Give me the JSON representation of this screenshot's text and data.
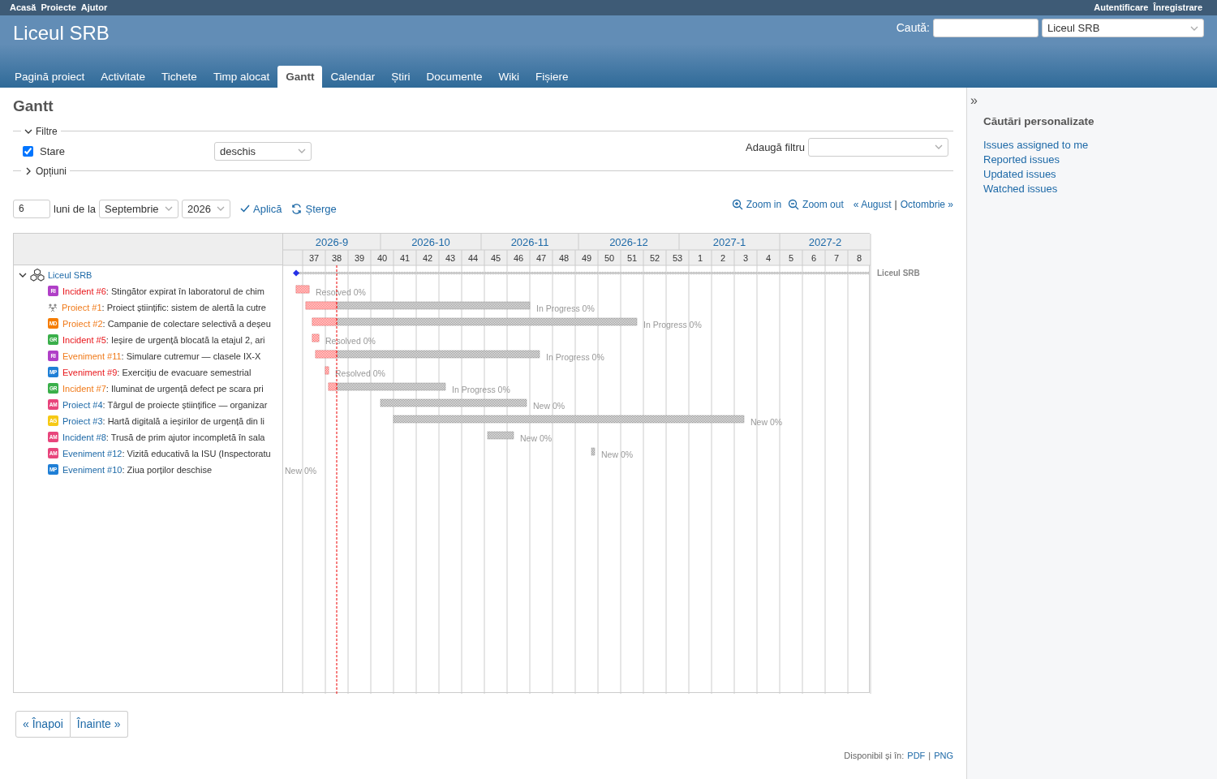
{
  "top_menu": {
    "left": [
      "Acasă",
      "Proiecte",
      "Ajutor"
    ],
    "right": [
      "Autentificare",
      "Înregistrare"
    ]
  },
  "header": {
    "title": "Liceul SRB",
    "search_label": "Caută:",
    "project_select": "Liceul SRB"
  },
  "tabs": [
    {
      "label": "Pagină proiect",
      "selected": false
    },
    {
      "label": "Activitate",
      "selected": false
    },
    {
      "label": "Tichete",
      "selected": false
    },
    {
      "label": "Timp alocat",
      "selected": false
    },
    {
      "label": "Gantt",
      "selected": true
    },
    {
      "label": "Calendar",
      "selected": false
    },
    {
      "label": "Știri",
      "selected": false
    },
    {
      "label": "Documente",
      "selected": false
    },
    {
      "label": "Wiki",
      "selected": false
    },
    {
      "label": "Fișiere",
      "selected": false
    }
  ],
  "page_title": "Gantt",
  "filters": {
    "legend": "Filtre",
    "expanded": true,
    "rows": [
      {
        "label": "Stare",
        "checked": true,
        "operator": "deschis"
      }
    ],
    "add_filter_label": "Adaugă filtru"
  },
  "options": {
    "legend": "Opțiuni",
    "expanded": false
  },
  "toolbar": {
    "months": "6",
    "months_label": "luni de la",
    "month": "Septembrie",
    "year": "2026",
    "apply": "Aplică",
    "clear": "Șterge",
    "zoom_in": "Zoom in",
    "zoom_out": "Zoom out",
    "prev": "« August",
    "separator": "|",
    "next": "Octombrie »"
  },
  "gantt": {
    "months": [
      "2026-9",
      "2026-10",
      "2026-11",
      "2026-12",
      "2027-1",
      "2027-2"
    ],
    "weeks": [
      "37",
      "38",
      "39",
      "40",
      "41",
      "42",
      "43",
      "44",
      "45",
      "46",
      "47",
      "48",
      "49",
      "50",
      "51",
      "52",
      "53",
      "1",
      "2",
      "3",
      "4",
      "5",
      "6",
      "7",
      "8"
    ],
    "project": {
      "name": "Liceul SRB",
      "expanded": true,
      "label": "Liceul SRB"
    },
    "issues": [
      {
        "ref": "Incident #6",
        "subject": ": Stingător expirat în laboratorul de chim",
        "color": "#e8161b",
        "avatar": {
          "kind": "initials",
          "initials": "RI",
          "color": "#b03fc7"
        },
        "status": "Resolved 0%"
      },
      {
        "ref": "Proiect #1",
        "subject": ": Proiect științific: sistem de alertă la cutre",
        "color": "#f07a1a",
        "avatar": {
          "kind": "group"
        },
        "status": "In Progress 0%"
      },
      {
        "ref": "Proiect #2",
        "subject": ": Campanie de colectare selectivă a deșeu",
        "color": "#f07a1a",
        "avatar": {
          "kind": "initials",
          "initials": "MD",
          "color": "#f57c00"
        },
        "status": "In Progress 0%"
      },
      {
        "ref": "Incident #5",
        "subject": ": Ieșire de urgență blocată la etajul 2, ari",
        "color": "#e8161b",
        "avatar": {
          "kind": "initials",
          "initials": "GR",
          "color": "#3aaf4a"
        },
        "status": "Resolved 0%"
      },
      {
        "ref": "Eveniment #11",
        "subject": ": Simulare cutremur — clasele IX-X",
        "color": "#f07a1a",
        "avatar": {
          "kind": "initials",
          "initials": "RI",
          "color": "#b03fc7"
        },
        "status": "In Progress 0%"
      },
      {
        "ref": "Eveniment #9",
        "subject": ": Exercițiu de evacuare semestrial",
        "color": "#e8161b",
        "avatar": {
          "kind": "initials",
          "initials": "MP",
          "color": "#1f7fd6"
        },
        "status": "Resolved 0%"
      },
      {
        "ref": "Incident #7",
        "subject": ": Iluminat de urgență defect pe scara pri",
        "color": "#f07a1a",
        "avatar": {
          "kind": "initials",
          "initials": "GR",
          "color": "#3aaf4a"
        },
        "status": "In Progress 0%"
      },
      {
        "ref": "Proiect #4",
        "subject": ": Târgul de proiecte științifice — organizar",
        "color": "#1d69a7",
        "avatar": {
          "kind": "initials",
          "initials": "AM",
          "color": "#e8457c"
        },
        "status": "New 0%"
      },
      {
        "ref": "Proiect #3",
        "subject": ": Hartă digitală a ieșirilor de urgență din li",
        "color": "#1d69a7",
        "avatar": {
          "kind": "initials",
          "initials": "AG",
          "color": "#f6c915"
        },
        "status": "New 0%"
      },
      {
        "ref": "Incident #8",
        "subject": ": Trusă de prim ajutor incompletă în sala",
        "color": "#1d69a7",
        "avatar": {
          "kind": "initials",
          "initials": "AM",
          "color": "#e8457c"
        },
        "status": "New 0%"
      },
      {
        "ref": "Eveniment #12",
        "subject": ": Vizită educativă la ISU (Inspectoratu",
        "color": "#1d69a7",
        "avatar": {
          "kind": "initials",
          "initials": "AM",
          "color": "#e8457c"
        },
        "status": "New 0%"
      },
      {
        "ref": "Eveniment #10",
        "subject": ": Ziua porților deschise",
        "color": "#1d69a7",
        "avatar": {
          "kind": "initials",
          "initials": "MP",
          "color": "#1f7fd6"
        },
        "status": "New 0%"
      }
    ]
  },
  "pagination": {
    "prev": "« Înapoi",
    "next": "Înainte »"
  },
  "export": {
    "label": "Disponibil și în:",
    "formats": [
      "PDF",
      "PNG"
    ],
    "separator": "|"
  },
  "sidebar": {
    "toggle": "»",
    "title": "Căutări personalizate",
    "queries": [
      "Issues assigned to me",
      "Reported issues",
      "Updated issues",
      "Watched issues"
    ]
  }
}
